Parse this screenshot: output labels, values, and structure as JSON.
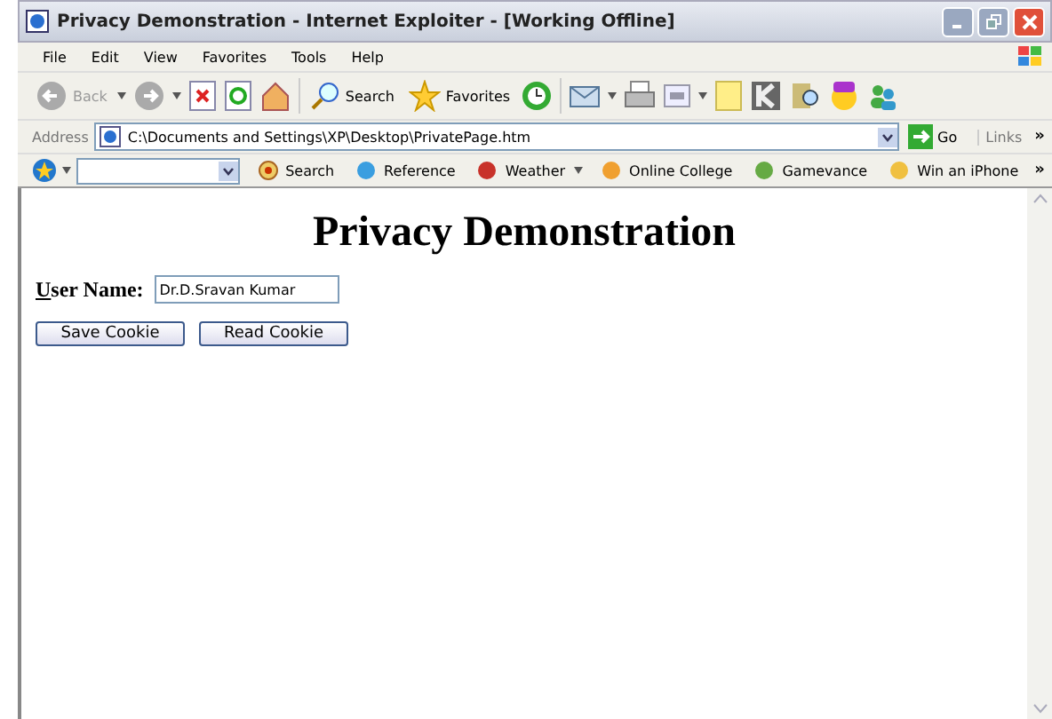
{
  "window": {
    "title": "Privacy Demonstration - Internet Exploiter - [Working Offline]"
  },
  "menu": [
    "File",
    "Edit",
    "View",
    "Favorites",
    "Tools",
    "Help"
  ],
  "toolbar": {
    "back": "Back",
    "search": "Search",
    "favorites": "Favorites"
  },
  "address": {
    "label": "Address",
    "value": "C:\\Documents and Settings\\XP\\Desktop\\PrivatePage.htm",
    "go": "Go",
    "links": "Links",
    "more": "»"
  },
  "links_bar": {
    "search": "Search",
    "items": [
      "Reference",
      "Weather",
      "Online College",
      "Gamevance",
      "Win an iPhone"
    ],
    "more": "»"
  },
  "page": {
    "heading": "Privacy Demonstration",
    "field_label": "User Name:",
    "field_value": "Dr.D.Sravan Kumar",
    "buttons": [
      "Save Cookie",
      "Read Cookie"
    ]
  }
}
